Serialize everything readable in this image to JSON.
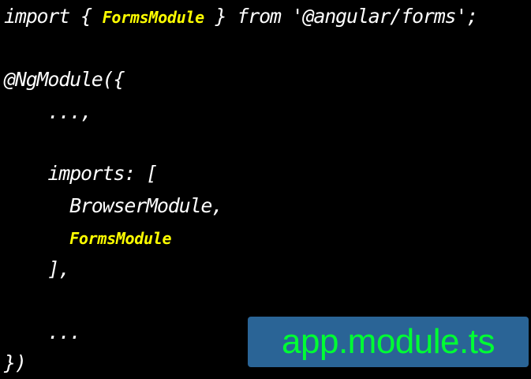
{
  "code": {
    "line1": {
      "before": "import { ",
      "highlight": "FormsModule",
      "after": " } from '@angular/forms';"
    },
    "line2": "@NgModule({",
    "line3": "    ...,",
    "line4": "    imports: [",
    "line5": "      BrowserModule,",
    "line6": {
      "indent": "      ",
      "highlight": "FormsModule"
    },
    "line7": "    ],",
    "line8": "    ...",
    "line9": "})"
  },
  "badge": {
    "filename": "app.module.ts"
  },
  "colors": {
    "background": "#000000",
    "text": "#ffffff",
    "highlight": "#ffff00",
    "badge_background": "#2a6496",
    "badge_text": "#00ff33"
  }
}
